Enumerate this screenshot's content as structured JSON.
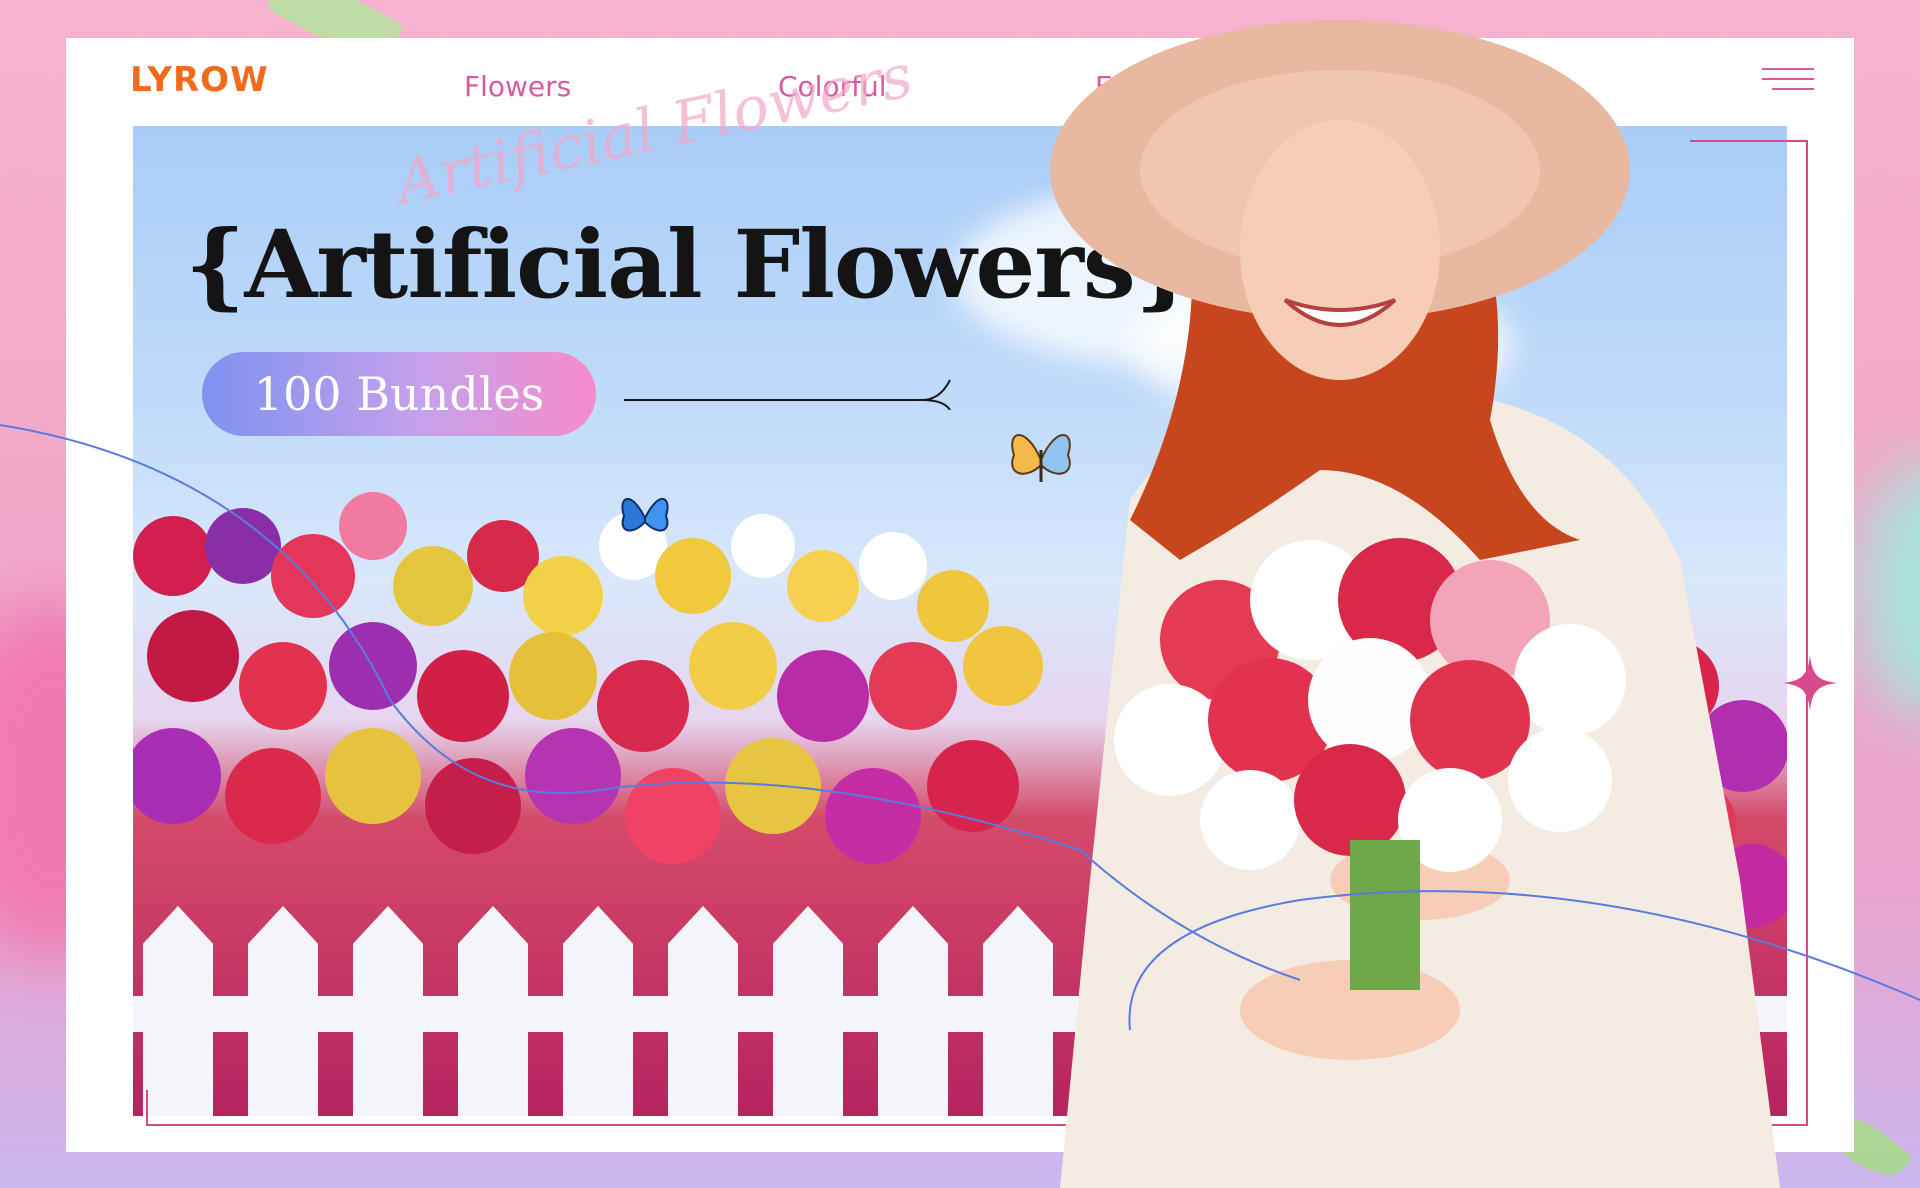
{
  "brand": {
    "logo_text": "LYROW"
  },
  "nav": {
    "items": [
      {
        "label": "Flowers"
      },
      {
        "label": "Colorful"
      },
      {
        "label": "Easy"
      }
    ]
  },
  "hero": {
    "script_text": "Artificial Flowers",
    "title": "{Artificial Flowers}",
    "cta_label": "100 Bundles"
  },
  "colors": {
    "accent_pink": "#d85aa0",
    "logo_orange": "#f26b1d",
    "logo_blue": "#2f80ed",
    "pill_gradient_start": "#7d92f0",
    "pill_gradient_end": "#f78bc9"
  },
  "icons": [
    "menu-icon",
    "butterfly-icon",
    "sparkle-icon"
  ]
}
